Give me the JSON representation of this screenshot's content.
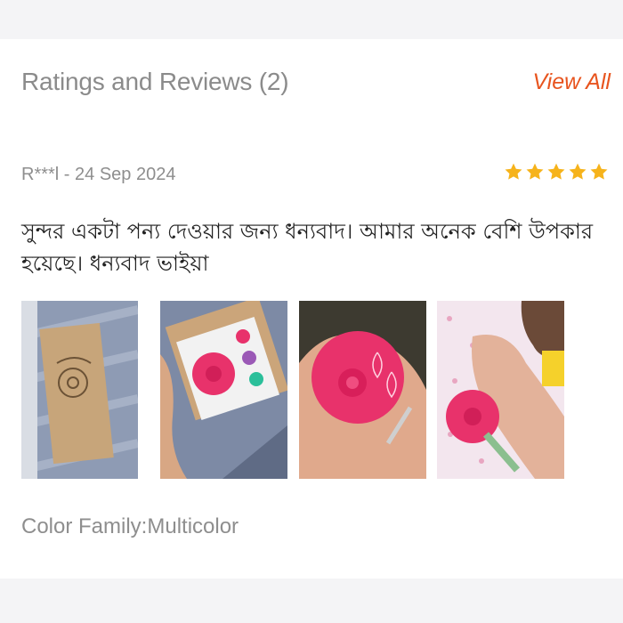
{
  "reviews_section": {
    "title": "Ratings and Reviews (2)",
    "view_all_label": "View All"
  },
  "review": {
    "reviewer_and_date": "R***l - 24 Sep 2024",
    "rating": 5,
    "rating_max": 5,
    "star_color": "#f6b31b",
    "text": "সুন্দর একটা পন্য দেওয়ার জন্য ধন্যবাদ। আমার অনেক বেশি উপকার হয়েছে। ধন্যবাদ ভাইয়া",
    "photos": [
      {
        "icon": "product-box-photo"
      },
      {
        "icon": "opened-box-pink-device-photo"
      },
      {
        "icon": "hand-holding-pink-device-photo"
      },
      {
        "icon": "baby-with-pink-device-photo"
      }
    ],
    "variant": "Color Family:Multicolor"
  },
  "colors": {
    "accent": "#e8541e",
    "muted_text": "#8b8b8b",
    "product_pink": "#e8326b"
  }
}
